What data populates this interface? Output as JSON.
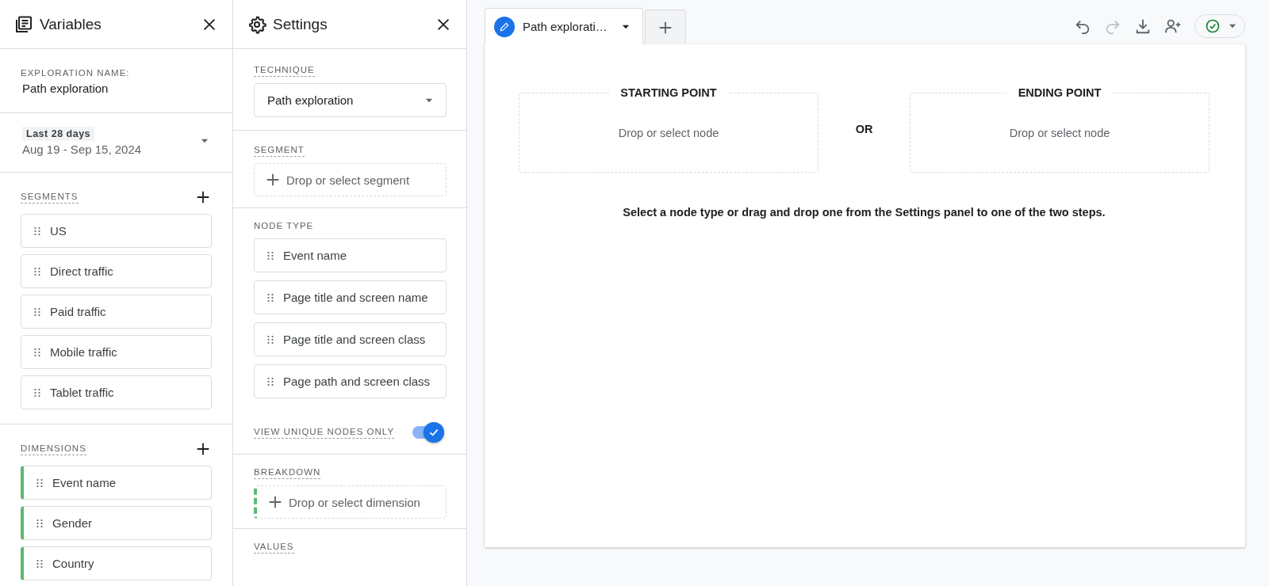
{
  "variables": {
    "title": "Variables",
    "exploration_label": "EXPLORATION NAME:",
    "exploration_name": "Path exploration",
    "date": {
      "badge": "Last 28 days",
      "range": "Aug 19 - Sep 15, 2024"
    },
    "segments": {
      "title": "SEGMENTS",
      "items": [
        {
          "label": "US"
        },
        {
          "label": "Direct traffic"
        },
        {
          "label": "Paid traffic"
        },
        {
          "label": "Mobile traffic"
        },
        {
          "label": "Tablet traffic"
        }
      ]
    },
    "dimensions": {
      "title": "DIMENSIONS",
      "items": [
        {
          "label": "Event name"
        },
        {
          "label": "Gender"
        },
        {
          "label": "Country"
        }
      ]
    }
  },
  "settings": {
    "title": "Settings",
    "technique": {
      "label": "TECHNIQUE",
      "value": "Path exploration"
    },
    "segment": {
      "label": "SEGMENT",
      "placeholder": "Drop or select segment"
    },
    "node_type": {
      "label": "NODE TYPE",
      "items": [
        {
          "label": "Event name"
        },
        {
          "label": "Page title and screen name"
        },
        {
          "label": "Page title and screen class"
        },
        {
          "label": "Page path and screen class"
        }
      ]
    },
    "unique_nodes": {
      "label": "VIEW UNIQUE NODES ONLY",
      "on": true
    },
    "breakdown": {
      "label": "BREAKDOWN",
      "placeholder": "Drop or select dimension"
    },
    "values": {
      "label": "VALUES"
    }
  },
  "tabs": [
    {
      "label": "Path explorati…",
      "selected": true
    }
  ],
  "toolbar": [
    {
      "kind": "undo",
      "disabled": false
    },
    {
      "kind": "redo",
      "disabled": true
    },
    {
      "kind": "download",
      "disabled": false
    },
    {
      "kind": "share",
      "disabled": false
    },
    {
      "kind": "status",
      "disabled": false
    }
  ],
  "canvas": {
    "start": {
      "title": "STARTING POINT",
      "placeholder": "Drop or select node"
    },
    "or": "OR",
    "end": {
      "title": "ENDING POINT",
      "placeholder": "Drop or select node"
    },
    "hint": "Select a node type or drag and drop one from the Settings panel to one of the two steps."
  }
}
